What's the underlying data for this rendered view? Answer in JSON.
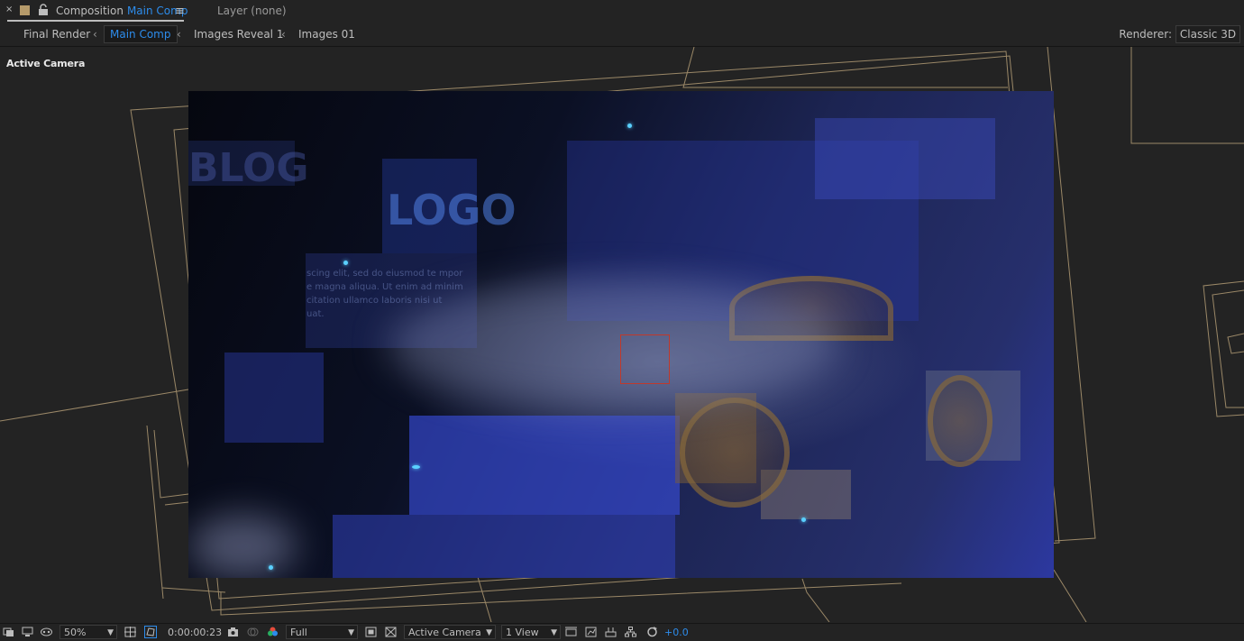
{
  "panel": {
    "comp_prefix": "Composition",
    "comp_name": "Main Comp",
    "layer_label": "Layer",
    "layer_value": "(none)"
  },
  "breadcrumbs": [
    {
      "label": "Final Render"
    },
    {
      "label": "Main Comp"
    },
    {
      "label": "Images Reveal 1"
    },
    {
      "label": "Images 01"
    }
  ],
  "renderer": {
    "label": "Renderer:",
    "value": "Classic 3D"
  },
  "viewer": {
    "camera_label": "Active Camera",
    "frame_text_blog": "BLOG",
    "frame_text_logo": "LOGO",
    "lorem_lines": [
      "scing elit, sed do eiusmod te mpor",
      "e magna aliqua. Ut enim ad minim",
      "citation ullamco laboris nisi ut",
      "uat."
    ]
  },
  "toolbar": {
    "zoom": "50%",
    "timecode": "0:00:00:23",
    "resolution": "Full",
    "view": "Active Camera",
    "layout": "1 View",
    "exposure": "+0.0"
  },
  "colors": {
    "accent_blue": "#2d8ceb",
    "wire_tan": "#b09a74",
    "box_red": "#c0392b"
  }
}
